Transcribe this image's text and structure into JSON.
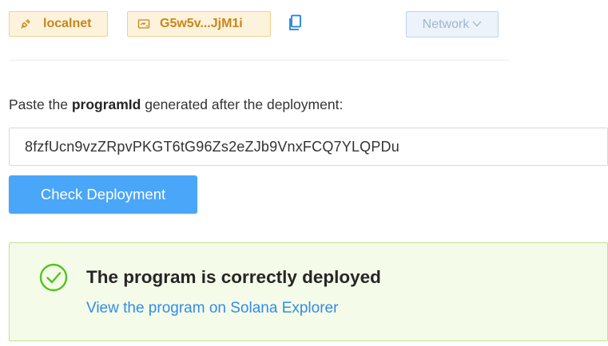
{
  "header": {
    "network_chip": {
      "label": "localnet",
      "icon": "plug-icon"
    },
    "wallet_chip": {
      "label": "G5w5v...JjM1i",
      "icon": "wallet-icon"
    },
    "copy_icon": "copy-icon",
    "network_select": {
      "label": "Network",
      "icon": "chevron-down-icon"
    }
  },
  "form": {
    "prompt_prefix": "Paste the ",
    "prompt_bold": "programId",
    "prompt_suffix": " generated after the deployment:",
    "program_id_value": "8fzfUcn9vzZRpvPKGT6tG96Zs2eZJb9VnxFCQ7YLQPDu",
    "check_button_label": "Check Deployment"
  },
  "result": {
    "title": "The program is correctly deployed",
    "link_text": "View the program on Solana Explorer",
    "icon": "check-circle-icon"
  },
  "colors": {
    "chip_bg": "#fdf3dc",
    "chip_text": "#c8861a",
    "button_primary": "#4aa6f8",
    "success_bg": "#f5fbe9",
    "success_border": "#b9e68e",
    "success_icon": "#52c41a",
    "link": "#2f8de8"
  }
}
